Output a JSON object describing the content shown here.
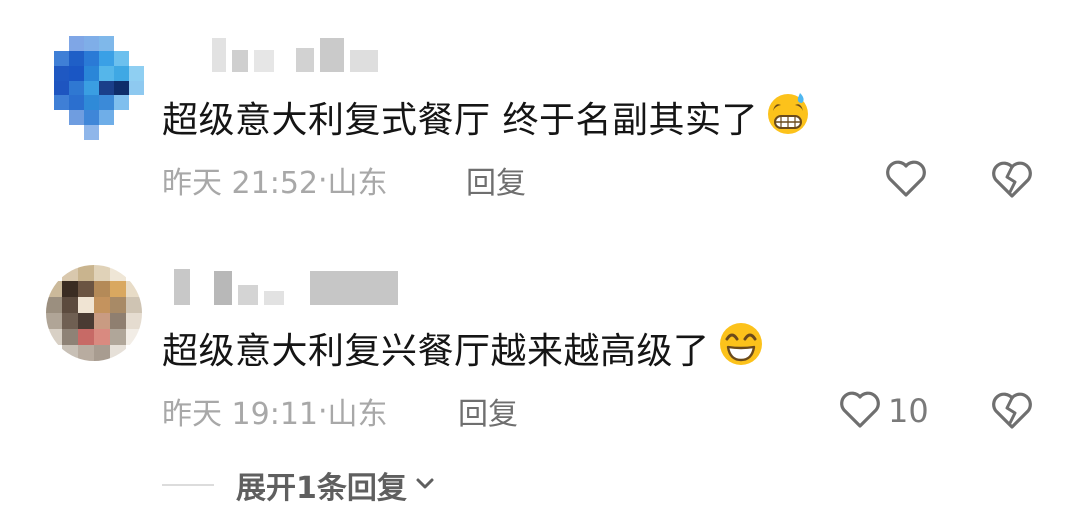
{
  "comments": [
    {
      "text": "超级意大利复式餐厅 终于名副其实了",
      "emoji": "grinning-sweat-emoji",
      "time": "昨天 21:52",
      "location": "山东",
      "reply_label": "回复",
      "like_count": "",
      "icons": [
        "heart-outline-icon",
        "broken-heart-icon"
      ]
    },
    {
      "text": "超级意大利复兴餐厅越来越高级了",
      "emoji": "smiling-emoji",
      "time": "昨天 19:11",
      "location": "山东",
      "reply_label": "回复",
      "like_count": "10",
      "icons": [
        "heart-outline-icon",
        "broken-heart-icon"
      ],
      "expand_label": "展开1条回复"
    }
  ],
  "colors": {
    "text": "#151515",
    "meta": "#a8a8a8",
    "icon": "#6f6f6f",
    "emoji_face": "#fcc21b"
  }
}
